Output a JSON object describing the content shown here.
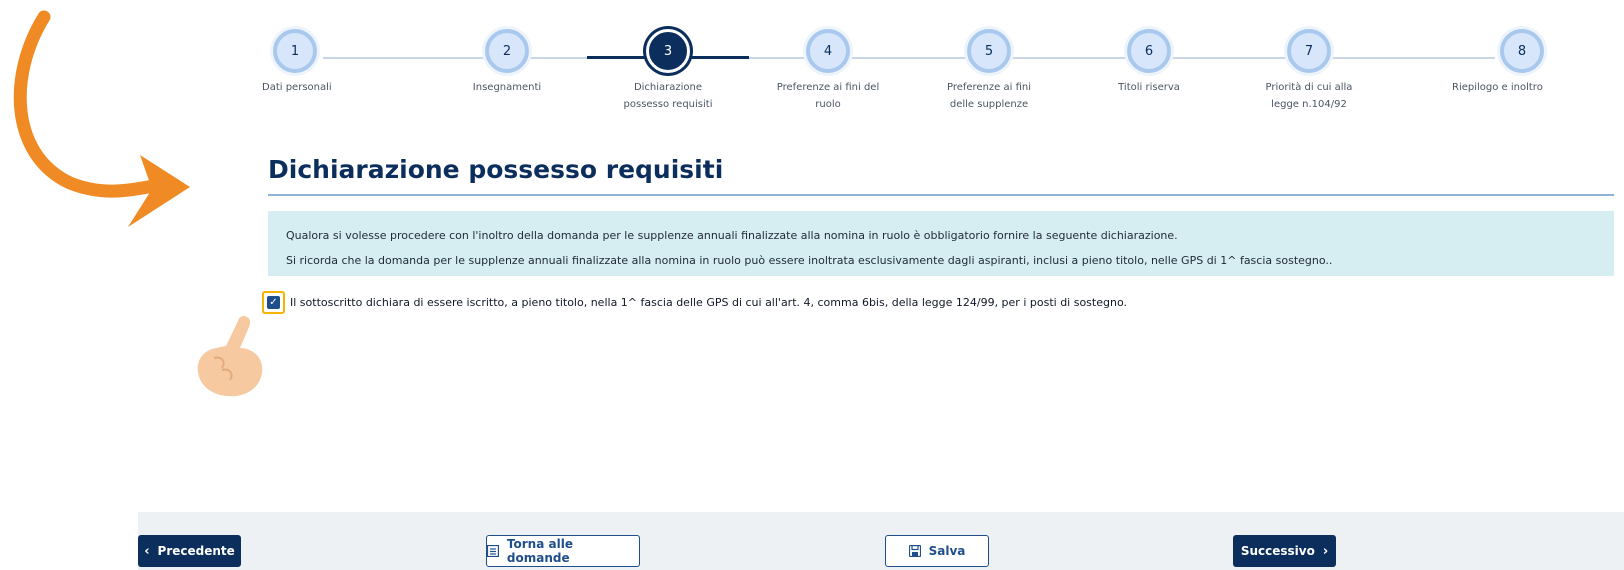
{
  "stepper": {
    "steps": [
      {
        "number": "1",
        "label_1": "Dati personali",
        "label_2": ""
      },
      {
        "number": "2",
        "label_1": "Insegnamenti",
        "label_2": ""
      },
      {
        "number": "3",
        "label_1": "Dichiarazione",
        "label_2": "possesso requisiti"
      },
      {
        "number": "4",
        "label_1": "Preferenze ai fini del",
        "label_2": "ruolo"
      },
      {
        "number": "5",
        "label_1": "Preferenze ai fini",
        "label_2": "delle supplenze"
      },
      {
        "number": "6",
        "label_1": "Titoli riserva",
        "label_2": ""
      },
      {
        "number": "7",
        "label_1": "Priorità di cui alla",
        "label_2": "legge n.104/92"
      },
      {
        "number": "8",
        "label_1": "Riepilogo e inoltro",
        "label_2": ""
      }
    ],
    "active_step": 3
  },
  "page": {
    "title": "Dichiarazione possesso requisiti"
  },
  "info": {
    "line_1": "Qualora si volesse procedere con l'inoltro della domanda per le supplenze annuali finalizzate alla nomina in ruolo è obbligatorio fornire la seguente dichiarazione.",
    "line_2": "Si ricorda che la domanda per le supplenze annuali finalizzate alla nomina in ruolo può essere inoltrata esclusivamente dagli aspiranti, inclusi a pieno titolo, nelle GPS di 1^ fascia sostegno.."
  },
  "consent": {
    "checked": true,
    "label": "Il sottoscritto dichiara di essere iscritto, a pieno titolo, nella 1^ fascia delle GPS di cui all'art. 4, comma 6bis, della legge 124/99, per i posti di sostegno."
  },
  "footer": {
    "prev_label": "Precedente",
    "back_label": "Torna alle domande",
    "save_label": "Salva",
    "next_label": "Successivo"
  },
  "icons": {
    "prev": "chevron-left-icon",
    "back": "list-icon",
    "save": "floppy-disk-icon",
    "next": "chevron-right-icon",
    "decoration_arrow": "curved-arrow-icon",
    "pointer": "pointing-hand-icon"
  },
  "colors": {
    "primary": "#0b2e5c",
    "info_background": "#d6eef2",
    "highlight": "#f5b400",
    "decoration": "#f08a24"
  }
}
